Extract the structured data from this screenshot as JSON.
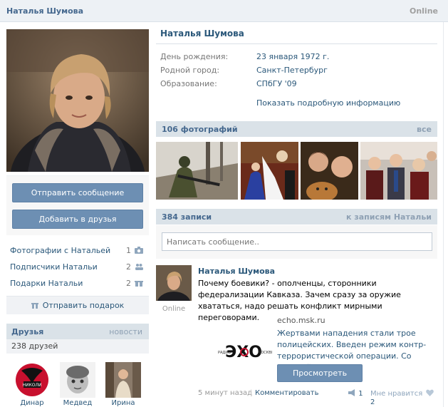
{
  "header": {
    "name": "Наталья Шумова",
    "status": "Online"
  },
  "profile": {
    "name": "Наталья Шумова",
    "info": [
      {
        "label": "День рождения:",
        "value": "23 января 1972 г."
      },
      {
        "label": "Родной город:",
        "value": "Санкт-Петербург"
      },
      {
        "label": "Образование:",
        "value": "СПбГУ '09"
      }
    ],
    "more_info": "Показать подробную информацию"
  },
  "actions": {
    "send_message": "Отправить сообщение",
    "add_friend": "Добавить в друзья",
    "send_gift": "Отправить подарок"
  },
  "left_links": [
    {
      "label": "Фотографии с Натальей",
      "count": "1",
      "icon": "camera-icon"
    },
    {
      "label": "Подписчики Натальи",
      "count": "2",
      "icon": "people-icon"
    },
    {
      "label": "Подарки Натальи",
      "count": "2",
      "icon": "gift-icon"
    }
  ],
  "friends": {
    "title": "Друзья",
    "news_link": "новости",
    "count_text": "238 друзей",
    "items": [
      {
        "name": "Динар"
      },
      {
        "name": "Медвед"
      },
      {
        "name": "Ирина"
      }
    ]
  },
  "photos": {
    "title": "106 фотографий",
    "all_link": "все"
  },
  "wall": {
    "title": "384 записи",
    "to_posts_link": "к записям Натальи",
    "input_placeholder": "Написать сообщение.."
  },
  "post": {
    "author": "Наталья Шумова",
    "online": "Online",
    "text": "Почему боевики? - ополченцы, сторонники федерализации Кавказа. Зачем сразу за оружие хвататься, надо решать конфликт мирными переговорами.",
    "attachment": {
      "domain": "echo.msk.ru",
      "logo_text": "ЭХО",
      "text": "Жертвами нападения стали трое полицейских. Введен режим контр-террористической операции. Со ссылкой...",
      "view_button": "Просмотреть"
    },
    "time": "5 минут назад",
    "separator": "|",
    "comment": "Комментировать",
    "reposts": "1",
    "likes_label": "Мне нравится",
    "likes": "2"
  },
  "colors": {
    "header_bg": "#edf1f5",
    "section_bg": "#dae2e8",
    "link": "#2b587a",
    "button": "#6d8fb3"
  }
}
